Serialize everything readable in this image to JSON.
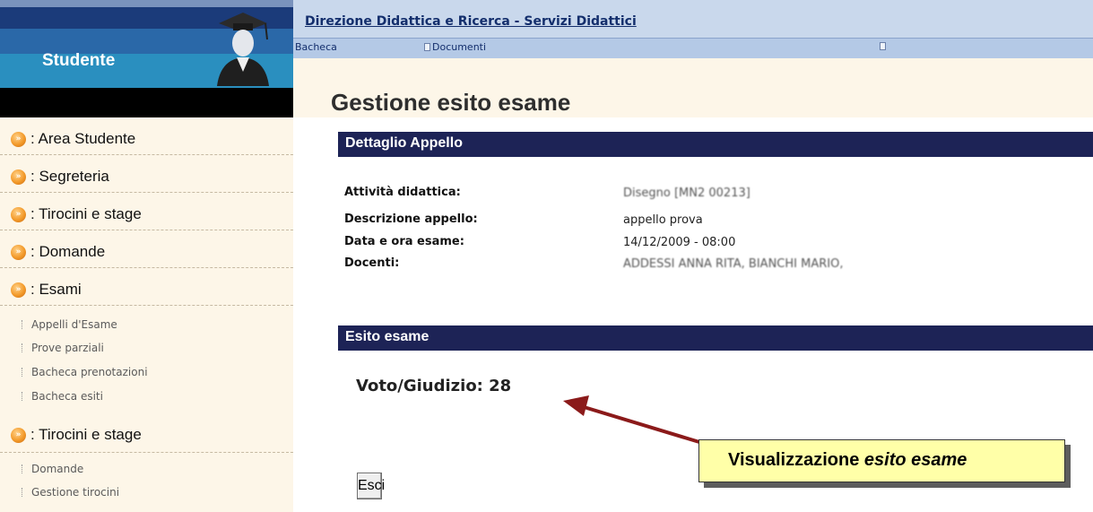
{
  "header": {
    "app_title": "Studente",
    "nav_title": "Direzione Didattica e Ricerca - Servizi Didattici",
    "tabs": [
      {
        "label": "Bacheca"
      },
      {
        "label": "Documenti"
      }
    ]
  },
  "sidebar": {
    "sections": [
      {
        "label": ": Area Studente",
        "icon": "orange-arrow-bullet-icon"
      },
      {
        "label": ": Segreteria",
        "icon": "orange-arrow-bullet-icon"
      },
      {
        "label": ": Tirocini e stage",
        "icon": "orange-arrow-bullet-icon"
      },
      {
        "label": ": Domande",
        "icon": "orange-arrow-bullet-icon"
      },
      {
        "label": ": Esami",
        "icon": "orange-arrow-bullet-icon"
      },
      {
        "label": ": Tirocini e stage",
        "icon": "orange-arrow-bullet-icon"
      }
    ],
    "esami_items": [
      "Appelli d'Esame",
      "Prove parziali",
      "Bacheca prenotazioni",
      "Bacheca esiti"
    ],
    "tirocini_items": [
      "Domande",
      "Gestione tirocini"
    ]
  },
  "main": {
    "page_title": "Gestione esito esame",
    "detail_section_title": "Dettaglio Appello",
    "details": [
      {
        "label": "Attività didattica:",
        "value": "Disegno [MN2 00213]"
      },
      {
        "label": "Descrizione appello:",
        "value": "appello prova"
      },
      {
        "label": "Data e ora esame:",
        "value": "14/12/2009 - 08:00"
      },
      {
        "label": "Docenti:",
        "value": "ADDESSI ANNA RITA, BIANCHI MARIO,"
      }
    ],
    "esito_section_title": "Esito esame",
    "voto_label": "Voto/Giudizio: 28",
    "exit_button": "Esci"
  },
  "annotation": {
    "text_plain": "Visualizzazione ",
    "text_italic": "esito esame"
  },
  "colors": {
    "section_bar": "#1d2356",
    "sidebar_bg": "#fdf6e8",
    "nav_bg": "#c9d8ec",
    "annotation_bg": "#ffffa8",
    "arrow": "#8b1a1a"
  }
}
